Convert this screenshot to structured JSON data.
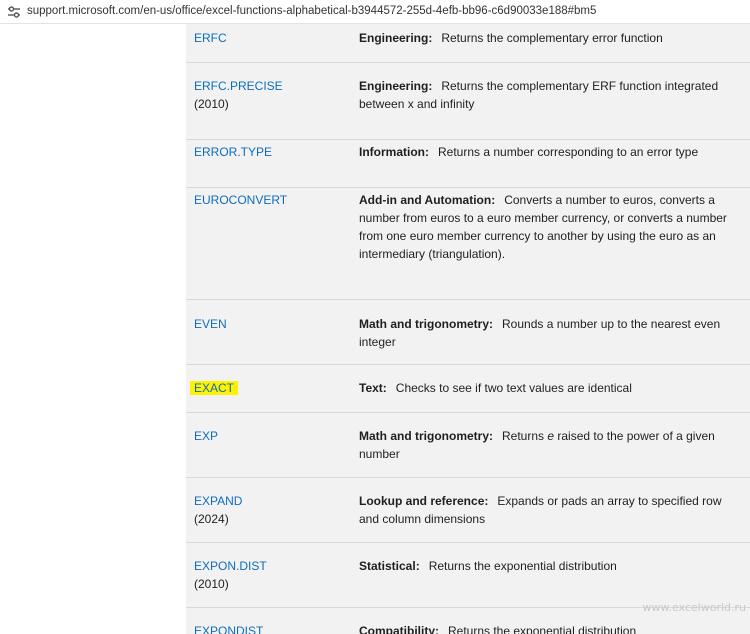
{
  "address_bar": {
    "url": "support.microsoft.com/en-us/office/excel-functions-alphabetical-b3944572-255d-4efb-bb96-c6d90033e188#bm5",
    "icon": "site-info-icon"
  },
  "rows": [
    {
      "fn": "ERFC",
      "version": "",
      "category": "Engineering:",
      "desc_before": "Returns the complementary error function",
      "emph": "",
      "desc_after": ""
    },
    {
      "fn": "ERFC.PRECISE",
      "version": "(2010)",
      "category": "Engineering:",
      "desc_before": "Returns the complementary ERF function integrated between x and infinity",
      "emph": "",
      "desc_after": ""
    },
    {
      "fn": "ERROR.TYPE",
      "version": "",
      "category": "Information:",
      "desc_before": "Returns a number corresponding to an error type",
      "emph": "",
      "desc_after": ""
    },
    {
      "fn": "EUROCONVERT",
      "version": "",
      "category": "Add-in and Automation:",
      "desc_before": "Converts a number to euros, converts a number from euros to a euro member currency, or converts a number from one euro member currency to another by using the euro as an intermediary (triangulation).",
      "emph": "",
      "desc_after": ""
    },
    {
      "fn": "EVEN",
      "version": "",
      "category": "Math and trigonometry:",
      "desc_before": "Rounds a number up to the nearest even integer",
      "emph": "",
      "desc_after": ""
    },
    {
      "fn": "EXACT",
      "version": "",
      "category": "Text:",
      "desc_before": "Checks to see if two text values are identical",
      "emph": "",
      "desc_after": "",
      "highlighted": true
    },
    {
      "fn": "EXP",
      "version": "",
      "category": "Math and trigonometry:",
      "desc_before": "Returns ",
      "emph": "e",
      "desc_after": " raised to the power of a given number"
    },
    {
      "fn": "EXPAND",
      "version": "(2024)",
      "category": "Lookup and reference:",
      "desc_before": "Expands or pads an array to specified row and column dimensions",
      "emph": "",
      "desc_after": ""
    },
    {
      "fn": "EXPON.DIST",
      "version": "(2010)",
      "category": "Statistical:",
      "desc_before": "Returns the exponential distribution",
      "emph": "",
      "desc_after": ""
    },
    {
      "fn": "EXPONDIST",
      "version": "",
      "category": "Compatibility:",
      "desc_before": "Returns the exponential distribution",
      "emph": "",
      "desc_after": ""
    }
  ],
  "watermark": "www.excelworld.ru",
  "colors": {
    "link": "#0f6cbd",
    "highlight": "#fff200",
    "row_bg": "#f2f2f2",
    "border": "#d9d9d9"
  }
}
